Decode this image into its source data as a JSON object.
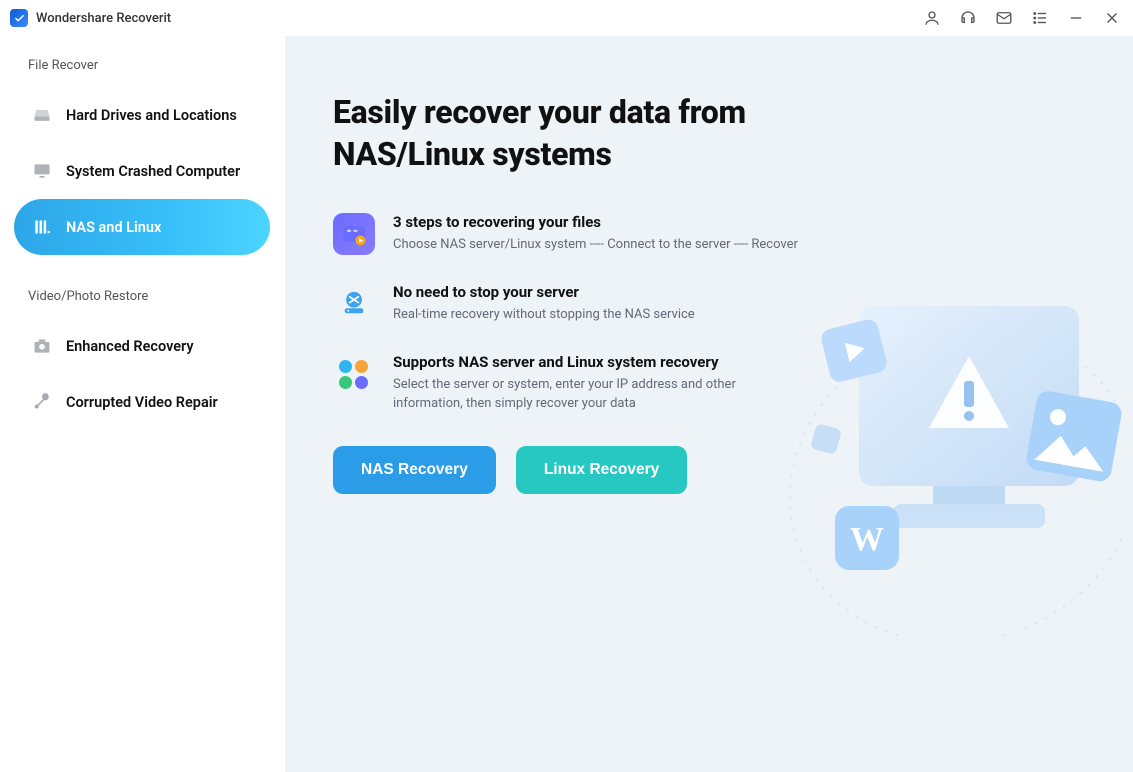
{
  "app": {
    "title": "Wondershare Recoverit"
  },
  "sidebar": {
    "section1_label": "File Recover",
    "section2_label": "Video/Photo Restore",
    "items": [
      {
        "label": "Hard Drives and Locations"
      },
      {
        "label": "System Crashed Computer"
      },
      {
        "label": "NAS and Linux"
      },
      {
        "label": "Enhanced Recovery"
      },
      {
        "label": "Corrupted Video Repair"
      }
    ]
  },
  "main": {
    "headline_line1": "Easily recover your data from",
    "headline_line2": "NAS/Linux systems",
    "features": [
      {
        "title": "3 steps to recovering your files",
        "desc": "Choose NAS server/Linux system ---- Connect to the server ---- Recover"
      },
      {
        "title": "No need to stop your server",
        "desc": "Real-time recovery without stopping the NAS service"
      },
      {
        "title_prefix": "Supports ",
        "hl1": "NAS server",
        "mid": " and ",
        "hl2": "Linux system",
        "title_suffix": " recovery",
        "desc": "Select the server or system, enter your IP address and other information, then simply recover your data"
      }
    ],
    "buttons": {
      "nas": "NAS Recovery",
      "linux": "Linux Recovery"
    }
  }
}
